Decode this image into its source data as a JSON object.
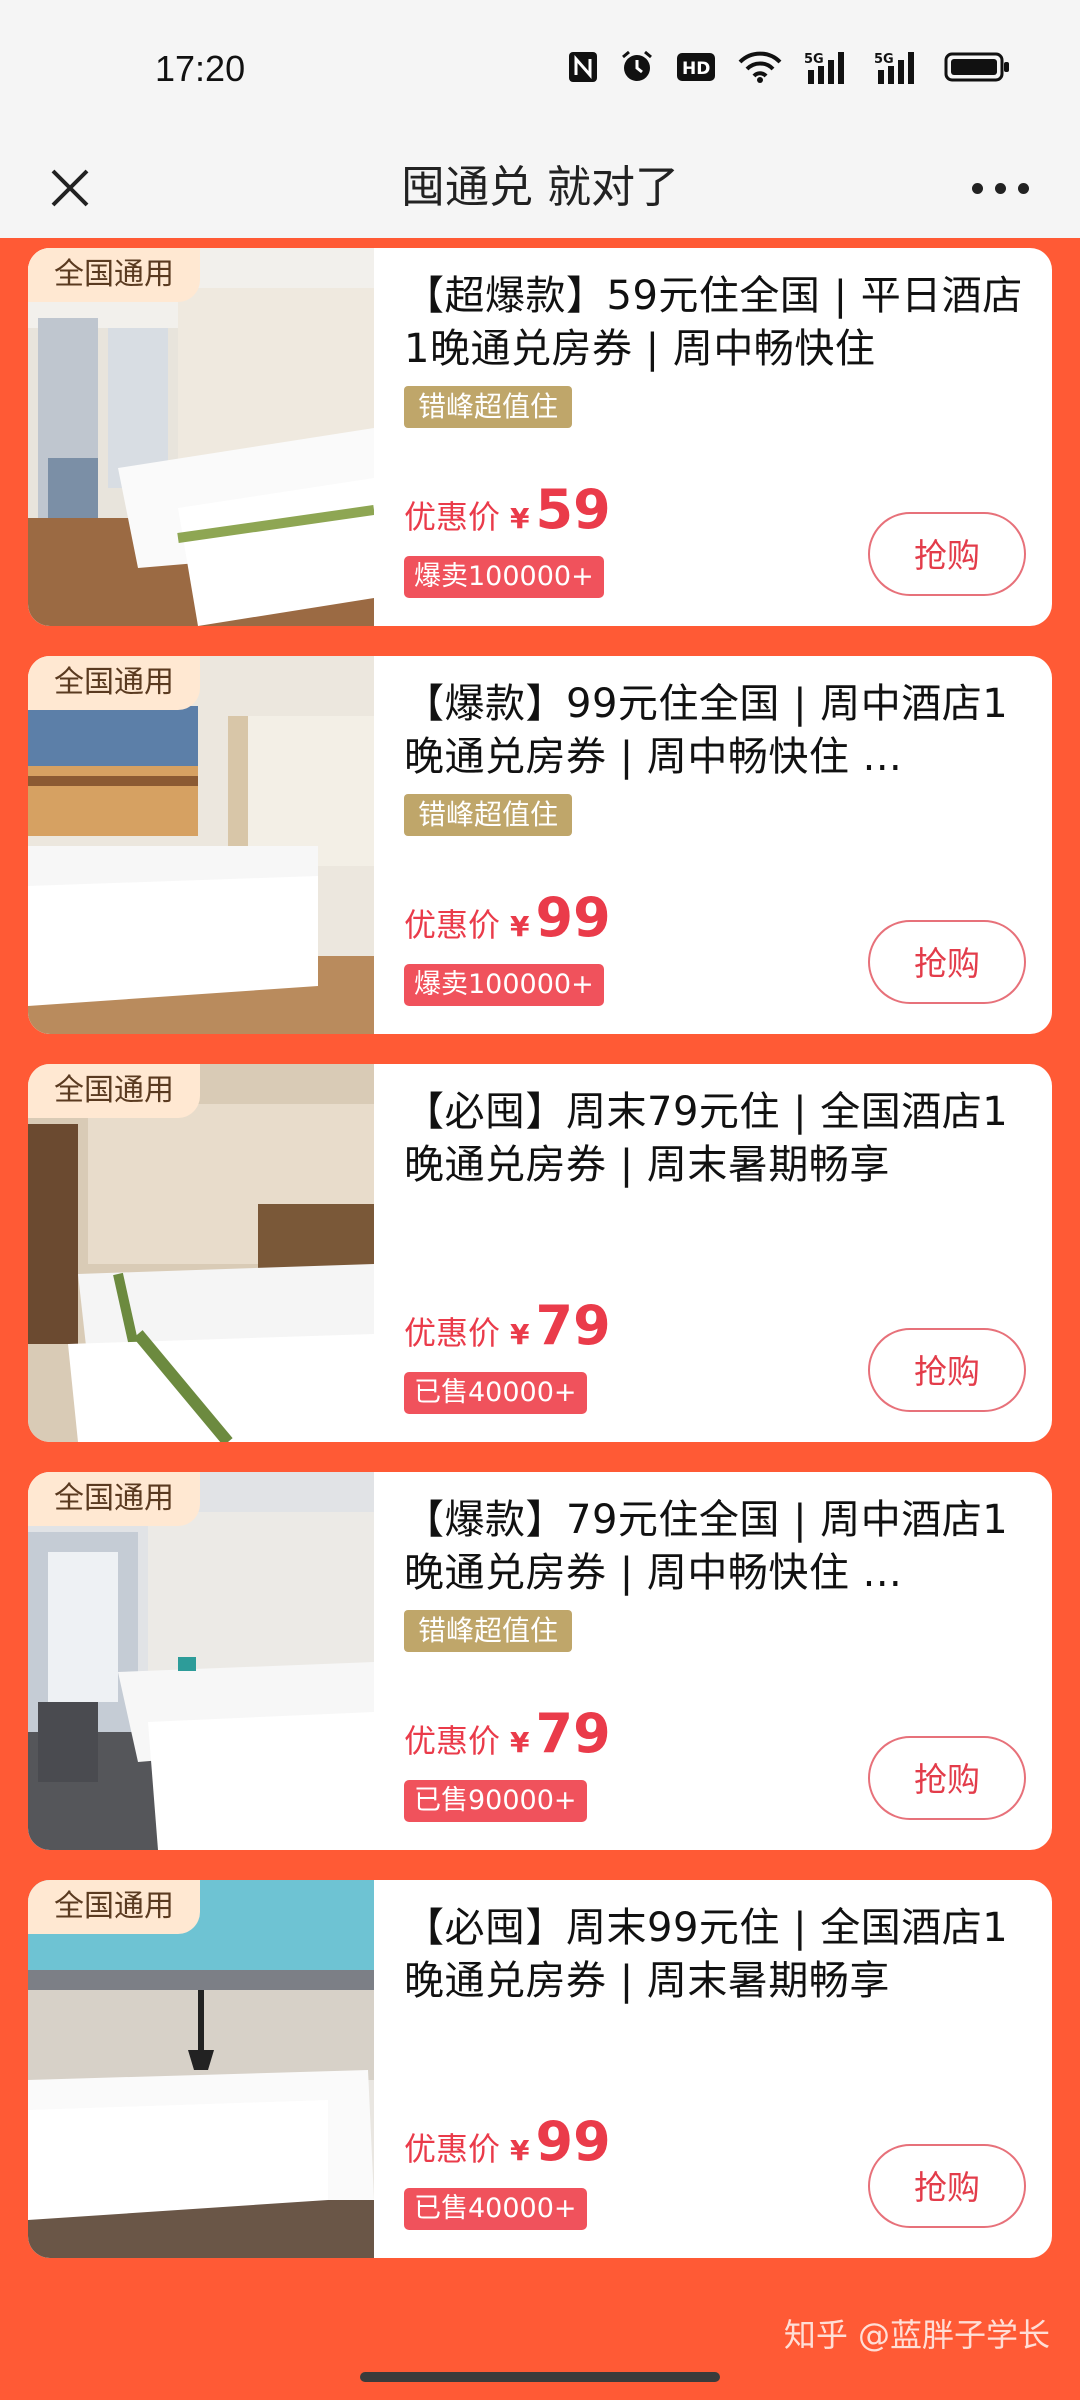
{
  "status_bar": {
    "time": "17:20",
    "icons": [
      "nfc-icon",
      "alarm-icon",
      "hd-icon",
      "wifi-icon",
      "5g-signal-icon",
      "5g-signal-icon",
      "battery-icon"
    ]
  },
  "nav": {
    "title": "囤通兑 就对了",
    "close_icon": "close-icon",
    "more_icon": "more-icon"
  },
  "colors": {
    "background": "#ff5a35",
    "price": "#ea3b4a",
    "promo_tag": "#bfa66a"
  },
  "cards": [
    {
      "thumb_tag": "全国通用",
      "title": "【超爆款】59元住全国 | 平日酒店1晚通兑房券 | 周中畅快住",
      "promo_tag": "错峰超值住",
      "price_label": "优惠价",
      "currency": "¥",
      "price": "59",
      "sold": "爆卖100000+",
      "buy_label": "抢购"
    },
    {
      "thumb_tag": "全国通用",
      "title": "【爆款】99元住全国 | 周中酒店1晚通兑房券 | 周中畅快住 ...",
      "promo_tag": "错峰超值住",
      "price_label": "优惠价",
      "currency": "¥",
      "price": "99",
      "sold": "爆卖100000+",
      "buy_label": "抢购"
    },
    {
      "thumb_tag": "全国通用",
      "title": "【必囤】周末79元住 | 全国酒店1晚通兑房券 | 周末暑期畅享",
      "promo_tag": "",
      "price_label": "优惠价",
      "currency": "¥",
      "price": "79",
      "sold": "已售40000+",
      "buy_label": "抢购"
    },
    {
      "thumb_tag": "全国通用",
      "title": "【爆款】79元住全国 | 周中酒店1晚通兑房券 | 周中畅快住 ...",
      "promo_tag": "错峰超值住",
      "price_label": "优惠价",
      "currency": "¥",
      "price": "79",
      "sold": "已售90000+",
      "buy_label": "抢购"
    },
    {
      "thumb_tag": "全国通用",
      "title": "【必囤】周末99元住 | 全国酒店1晚通兑房券 | 周末暑期畅享",
      "promo_tag": "",
      "price_label": "优惠价",
      "currency": "¥",
      "price": "99",
      "sold": "已售40000+",
      "buy_label": "抢购"
    }
  ],
  "watermark": "知乎 @蓝胖子学长"
}
